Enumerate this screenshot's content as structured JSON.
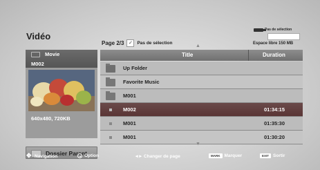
{
  "header": {
    "title": "Vidéo",
    "page": "Page 2/3",
    "select_label": "Pas de sélection"
  },
  "device": {
    "selection_label": "Pas de sélection",
    "free_space": "Espace libre 150 MB"
  },
  "preview": {
    "type_label": "Movie",
    "name": "M002",
    "resolution": "640x480, 720KB"
  },
  "parent_button": {
    "label": "Dossier Parent"
  },
  "list": {
    "columns": {
      "title": "Title",
      "duration": "Duration"
    },
    "rows": [
      {
        "icon": "up-folder-icon",
        "name": "Up Folder",
        "duration": ""
      },
      {
        "icon": "folder-icon",
        "name": "Favorite Music",
        "duration": ""
      },
      {
        "icon": "folder-icon",
        "name": "M001",
        "duration": ""
      },
      {
        "icon": "video-file-icon",
        "name": "M002",
        "duration": "01:34:15",
        "selected": true
      },
      {
        "icon": "video-file-icon",
        "name": "M001",
        "duration": "01:35:30"
      },
      {
        "icon": "video-file-icon",
        "name": "M001",
        "duration": "01:30:20"
      }
    ]
  },
  "footer": {
    "navigation": "Navigation",
    "option": "Option",
    "change_page": "Changer de page",
    "mark_key": "MARK",
    "mark": "Marquer",
    "exit_key": "EXIT",
    "exit": "Sortir"
  },
  "colors": {
    "selected_row": "#5e3a3a",
    "header_bar": "#707070"
  }
}
